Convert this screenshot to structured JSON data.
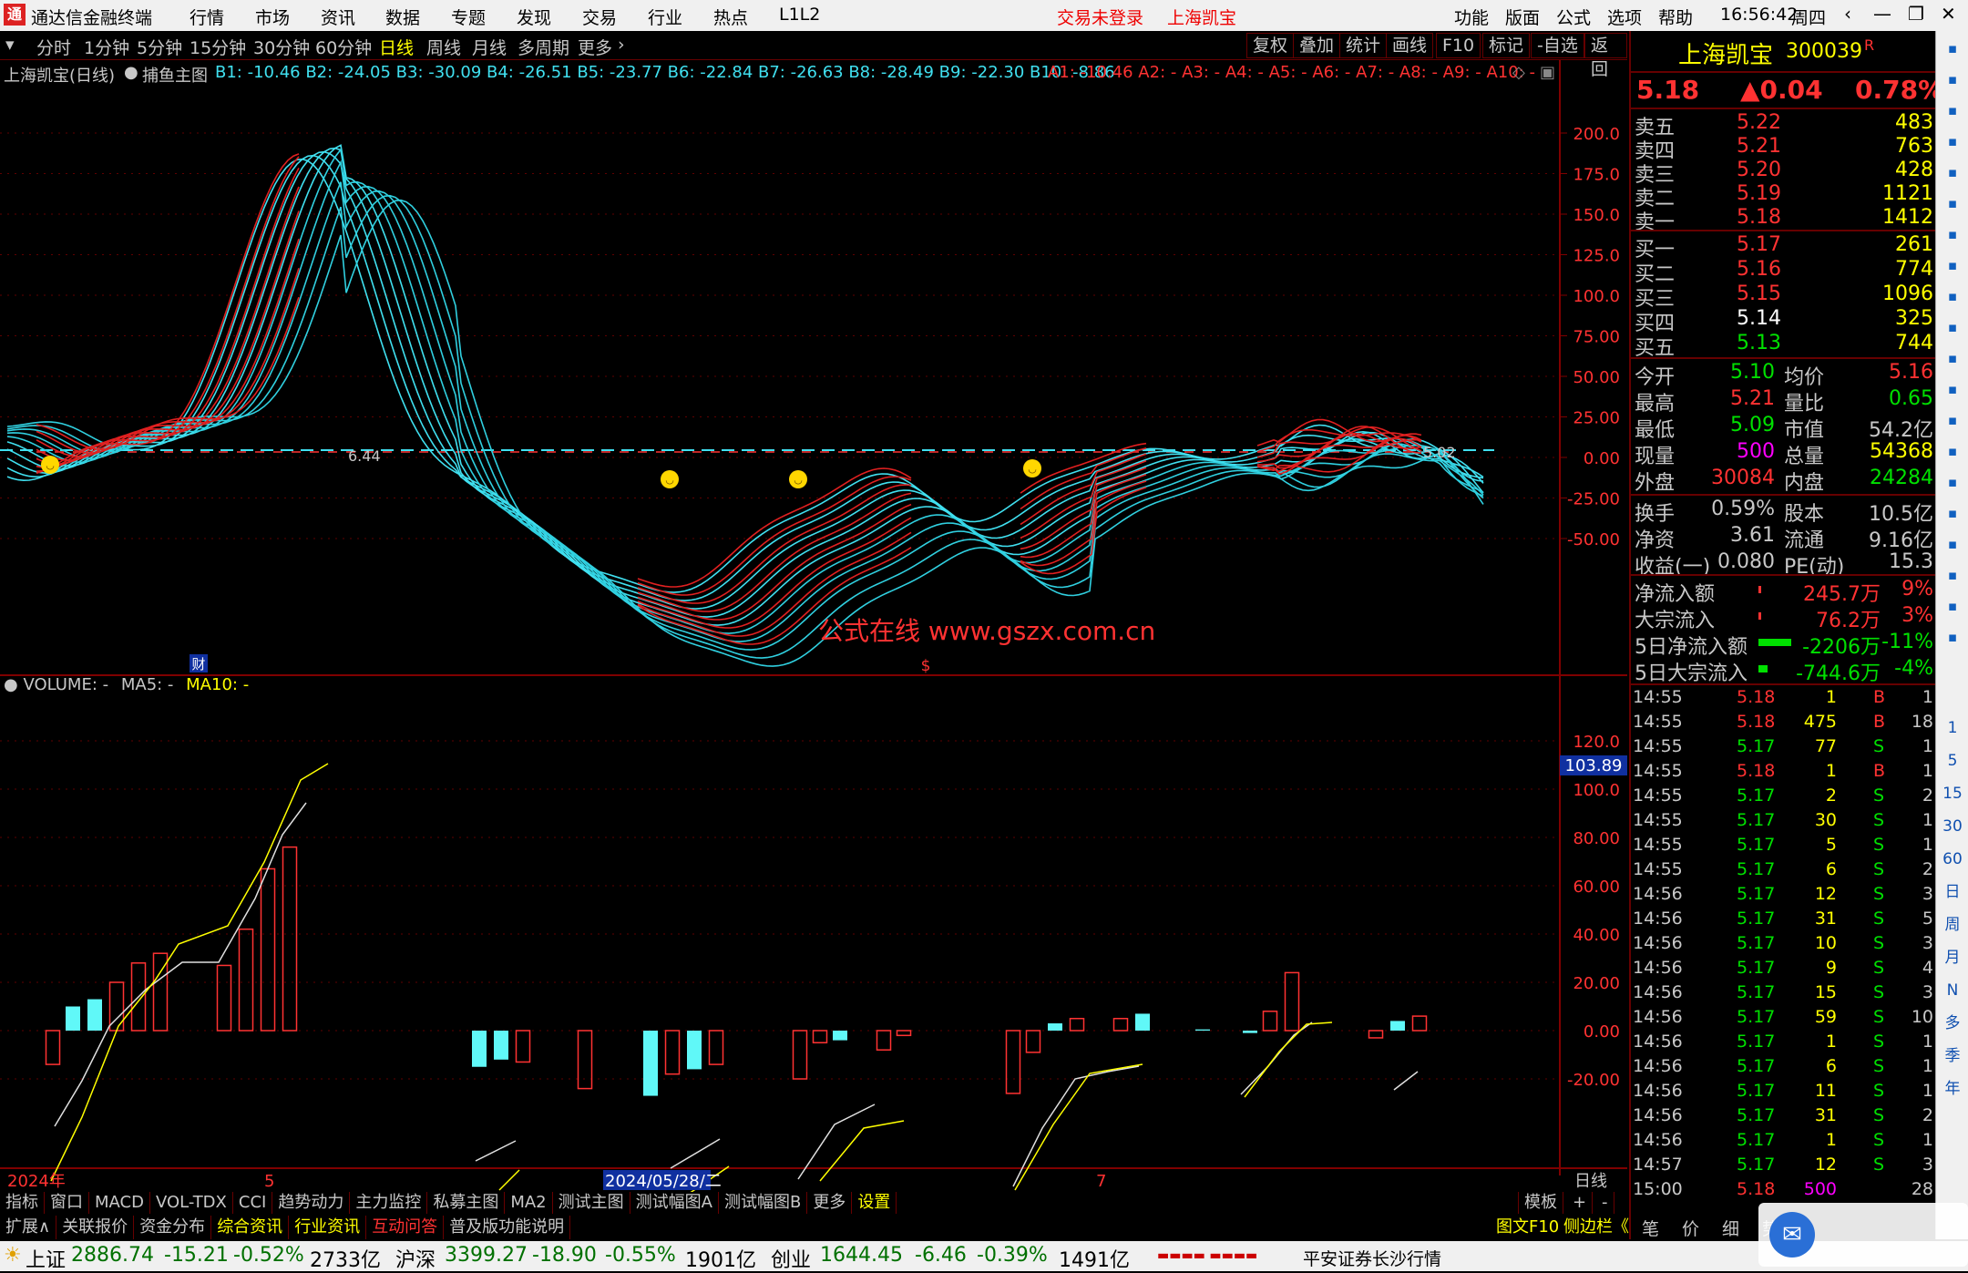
{
  "titlebar": {
    "app_name": "通达信金融终端",
    "menus": [
      "行情",
      "市场",
      "资讯",
      "数据",
      "专题",
      "发现",
      "交易",
      "行业",
      "热点",
      "L1L2"
    ],
    "trade_status": "交易未登录",
    "stock_name": "上海凯宝",
    "right_menus": [
      "功能",
      "版面",
      "公式",
      "选项",
      "帮助"
    ],
    "time": "16:56:42",
    "weekday": "周四"
  },
  "period_bar": {
    "items": [
      "分时",
      "1分钟",
      "5分钟",
      "15分钟",
      "30分钟",
      "60分钟",
      "日线",
      "周线",
      "月线",
      "多周期",
      "更多"
    ],
    "active": "日线",
    "tools": [
      "复权",
      "叠加",
      "统计",
      "画线",
      "F10",
      "标记",
      "-自选",
      "返回"
    ]
  },
  "main_chart": {
    "stock_title": "上海凯宝(日线)",
    "indicator": "捕鱼主图",
    "b_values": "B1: -10.46  B2: -24.05  B3: -30.09  B4: -26.51  B5: -23.77  B6: -22.84  B7: -26.63  B8: -28.49  B9: -22.30  B10: -8.86",
    "a_values": "A1: -10.46  A2: -  A3: -  A4: -  A5: -  A6: -  A7: -  A8: -  A9: -  A10: -",
    "y_ticks": [
      "200.0",
      "175.0",
      "150.0",
      "125.0",
      "100.0",
      "75.00",
      "50.00",
      "25.00",
      "0.00",
      "-25.00",
      "-50.00"
    ],
    "label_left": "6.44",
    "label_right": "5.02",
    "watermark_text": "公式在线  www.gszx.com.cn",
    "marker_cai": "财",
    "marker_s": "$"
  },
  "volume_chart": {
    "title": "VOLUME: -",
    "ma5": "MA5: -",
    "ma10": "MA10: -",
    "y_ticks": [
      "120.0",
      "100.0",
      "80.00",
      "60.00",
      "40.00",
      "20.00",
      "0.00",
      "-20.00"
    ],
    "current_value": "103.89"
  },
  "x_axis": {
    "labels": [
      "2024年",
      "5",
      "2024/05/28/二",
      "7"
    ],
    "period_label": "日线"
  },
  "bottom_tabs": [
    "指标",
    "窗口",
    "MACD",
    "VOL-TDX",
    "CCI",
    "趋势动力",
    "主力监控",
    "私募主图",
    "MA2",
    "测试主图",
    "测试幅图A",
    "测试幅图B",
    "更多",
    "设置"
  ],
  "bottom_tabs_active": "设置",
  "bottom_right": [
    "模板",
    "+",
    "-"
  ],
  "ext_tabs": [
    "扩展∧",
    "关联报价",
    "资金分布",
    "综合资讯",
    "行业资讯",
    "互动问答",
    "普及版功能说明"
  ],
  "ext_right": [
    "图文F10",
    "侧边栏《"
  ],
  "ticker": {
    "sh_name": "上证",
    "sh_val": "2886.74",
    "sh_chg": "-15.21",
    "sh_pct": "-0.52%",
    "sh_amt": "2733亿",
    "hs_name": "沪深",
    "hs_val": "3399.27",
    "hs_chg": "-18.90",
    "hs_pct": "-0.55%",
    "hs_amt": "1901亿",
    "cy_name": "创业",
    "cy_val": "1644.45",
    "cy_chg": "-6.46",
    "cy_pct": "-0.39%",
    "cy_amt": "1491亿",
    "broker": "平安证券长沙行情"
  },
  "quote": {
    "name": "上海凯宝",
    "code": "300039",
    "r_mark": "R",
    "price": "5.18",
    "change": "▲0.04",
    "pct": "0.78%",
    "asks": [
      {
        "label": "卖五",
        "price": "5.22",
        "vol": "483"
      },
      {
        "label": "卖四",
        "price": "5.21",
        "vol": "763"
      },
      {
        "label": "卖三",
        "price": "5.20",
        "vol": "428"
      },
      {
        "label": "卖二",
        "price": "5.19",
        "vol": "1121"
      },
      {
        "label": "卖一",
        "price": "5.18",
        "vol": "1412"
      }
    ],
    "bids": [
      {
        "label": "买一",
        "price": "5.17",
        "vol": "261"
      },
      {
        "label": "买二",
        "price": "5.16",
        "vol": "774"
      },
      {
        "label": "买三",
        "price": "5.15",
        "vol": "1096"
      },
      {
        "label": "买四",
        "price": "5.14",
        "vol": "325"
      },
      {
        "label": "买五",
        "price": "5.13",
        "vol": "744"
      }
    ],
    "stats": [
      {
        "l1": "今开",
        "v1": "5.10",
        "l2": "均价",
        "v2": "5.16"
      },
      {
        "l1": "最高",
        "v1": "5.21",
        "l2": "量比",
        "v2": "0.65"
      },
      {
        "l1": "最低",
        "v1": "5.09",
        "l2": "市值",
        "v2": "54.2亿"
      },
      {
        "l1": "现量",
        "v1": "500",
        "l2": "总量",
        "v2": "54368"
      },
      {
        "l1": "外盘",
        "v1": "30084",
        "l2": "内盘",
        "v2": "24284"
      }
    ],
    "stats2": [
      {
        "l1": "换手",
        "v1": "0.59%",
        "l2": "股本",
        "v2": "10.5亿"
      },
      {
        "l1": "净资",
        "v1": "3.61",
        "l2": "流通",
        "v2": "9.16亿"
      },
      {
        "l1": "收益(一)",
        "v1": "0.080",
        "l2": "PE(动)",
        "v2": "15.3"
      }
    ],
    "flows": [
      {
        "label": "净流入额",
        "value": "245.7万",
        "pct": "9%"
      },
      {
        "label": "大宗流入",
        "value": "76.2万",
        "pct": "3%"
      },
      {
        "label": "5日净流入额",
        "value": "-2206万",
        "pct": "-11%"
      },
      {
        "label": "5日大宗流入",
        "value": "-744.6万",
        "pct": "-4%"
      }
    ],
    "ticks": [
      {
        "t": "14:55",
        "p": "5.18",
        "v": "1",
        "s": "B",
        "n": "1"
      },
      {
        "t": "14:55",
        "p": "5.18",
        "v": "475",
        "s": "B",
        "n": "18"
      },
      {
        "t": "14:55",
        "p": "5.17",
        "v": "77",
        "s": "S",
        "n": "1"
      },
      {
        "t": "14:55",
        "p": "5.18",
        "v": "1",
        "s": "B",
        "n": "1"
      },
      {
        "t": "14:55",
        "p": "5.17",
        "v": "2",
        "s": "S",
        "n": "2"
      },
      {
        "t": "14:55",
        "p": "5.17",
        "v": "30",
        "s": "S",
        "n": "1"
      },
      {
        "t": "14:55",
        "p": "5.17",
        "v": "5",
        "s": "S",
        "n": "1"
      },
      {
        "t": "14:55",
        "p": "5.17",
        "v": "6",
        "s": "S",
        "n": "2"
      },
      {
        "t": "14:56",
        "p": "5.17",
        "v": "12",
        "s": "S",
        "n": "3"
      },
      {
        "t": "14:56",
        "p": "5.17",
        "v": "31",
        "s": "S",
        "n": "5"
      },
      {
        "t": "14:56",
        "p": "5.17",
        "v": "10",
        "s": "S",
        "n": "3"
      },
      {
        "t": "14:56",
        "p": "5.17",
        "v": "9",
        "s": "S",
        "n": "4"
      },
      {
        "t": "14:56",
        "p": "5.17",
        "v": "15",
        "s": "S",
        "n": "3"
      },
      {
        "t": "14:56",
        "p": "5.17",
        "v": "59",
        "s": "S",
        "n": "10"
      },
      {
        "t": "14:56",
        "p": "5.17",
        "v": "1",
        "s": "S",
        "n": "1"
      },
      {
        "t": "14:56",
        "p": "5.17",
        "v": "6",
        "s": "S",
        "n": "1"
      },
      {
        "t": "14:56",
        "p": "5.17",
        "v": "11",
        "s": "S",
        "n": "1"
      },
      {
        "t": "14:56",
        "p": "5.17",
        "v": "31",
        "s": "S",
        "n": "2"
      },
      {
        "t": "14:56",
        "p": "5.17",
        "v": "1",
        "s": "S",
        "n": "1"
      },
      {
        "t": "14:57",
        "p": "5.17",
        "v": "12",
        "s": "S",
        "n": "3"
      },
      {
        "t": "15:00",
        "p": "5.18",
        "v": "500",
        "s": "",
        "n": "28"
      }
    ],
    "bottom_tabs": [
      "笔",
      "价",
      "细",
      "势"
    ]
  },
  "sidebar_icons": [
    "expand-icon",
    "up-icon",
    "down-icon",
    "add-icon",
    "list-icon",
    "grid-icon",
    "line-chart-icon",
    "candle-icon",
    "table-icon",
    "fin-icon",
    "news-icon",
    "f10-icon",
    "f2-icon",
    "clock-icon",
    "doc-icon",
    "rsi-icon",
    "move-icon",
    "pen-icon",
    "f5-icon",
    "screen-icon"
  ],
  "sidebar_labels": [
    "1",
    "5",
    "15",
    "30",
    "60",
    "日",
    "周",
    "月",
    "N",
    "多",
    "季",
    "年"
  ],
  "colors": {
    "up": "#ff3232",
    "down": "#00e000",
    "cyan": "#40e0f0",
    "yellow": "#ffff00",
    "grid_red": "#800000"
  }
}
